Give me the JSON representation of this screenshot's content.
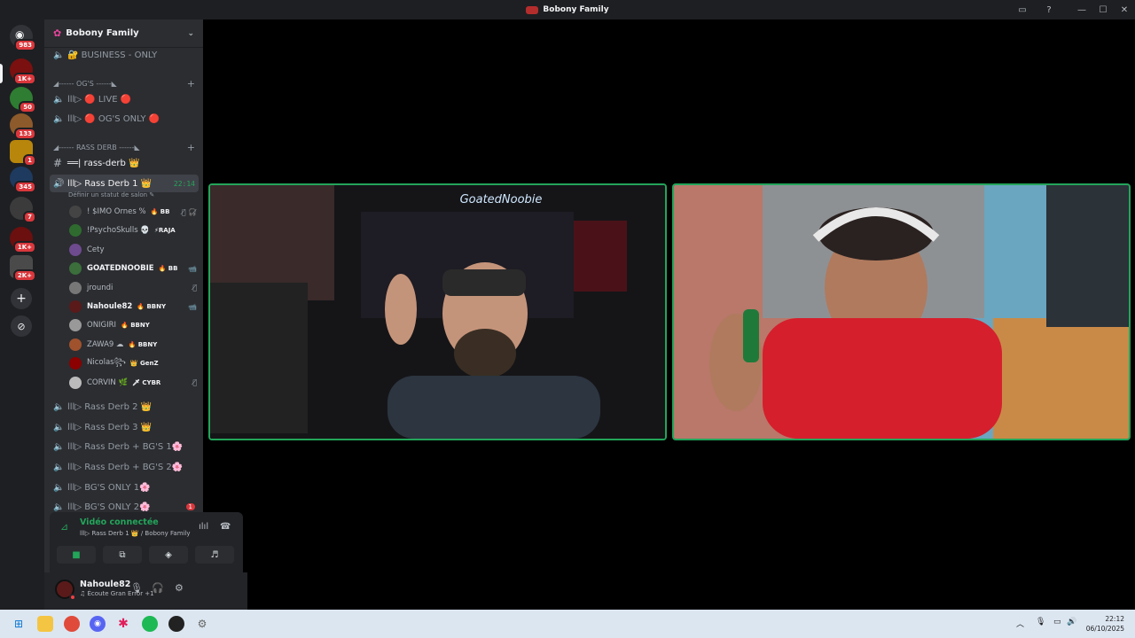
{
  "window": {
    "title": "Bobony Family",
    "controls": [
      "—",
      "☐",
      "✕"
    ]
  },
  "rail": {
    "servers": [
      {
        "name": "discord-home",
        "badge": "983",
        "color": "#313338"
      },
      {
        "name": "server-1",
        "badge": "1K+",
        "color": "#7a1010"
      },
      {
        "name": "server-2",
        "badge": "50",
        "color": "#2e7d32"
      },
      {
        "name": "server-3",
        "badge": "133",
        "color": "#8d5a2b"
      },
      {
        "name": "server-4",
        "badge": "1",
        "color": "#b8860b"
      },
      {
        "name": "server-5",
        "badge": "345",
        "color": "#1e3a5f"
      },
      {
        "name": "server-6",
        "badge": "7",
        "color": "#3b3b3b"
      },
      {
        "name": "server-7",
        "badge": "1K+",
        "color": "#6b0f0f"
      },
      {
        "name": "server-8",
        "badge": "2K+",
        "color": "#4a4a4a"
      }
    ]
  },
  "server": {
    "name": "Bobony Family"
  },
  "channels": {
    "business": "🔐 BUSINESS - ONLY",
    "cat_ogs": "◢------ OG'S ------◣",
    "live": "lll▷ 🔴 LIVE 🔴",
    "ogs_only": "lll▷ 🔴 OG'S ONLY 🔴",
    "cat_rass": "◢------ RASS DERB ------◣",
    "rass_text": "══| rass-derb 👑",
    "rass1": "lll▷ Rass Derb 1 👑",
    "rass1_time": "22:14",
    "rass1_status": "Définir un statut de salon ✎",
    "rass2": "lll▷ Rass Derb 2 👑",
    "rass3": "lll▷ Rass Derb 3 👑",
    "rass_bg1": "lll▷ Rass Derb + BG'S 1🌸",
    "rass_bg2": "lll▷ Rass Derb + BG'S 2🌸",
    "bg1": "lll▷ BG'S ONLY 1🌸",
    "bg2": "lll▷ BG'S ONLY 2🌸",
    "bg2_badge": "1"
  },
  "members": [
    {
      "name": "! $IMO Ornes %",
      "tag": "🔥 BB",
      "right": "🎙̸ 🎧̸",
      "color": "#444",
      "bold": false
    },
    {
      "name": "!PsychoSkulls 💀",
      "tag": "⚡RAJA",
      "right": "",
      "color": "#2f6b2f",
      "bold": false
    },
    {
      "name": "Cety",
      "tag": "",
      "right": "",
      "color": "#6e4a8e",
      "bold": false
    },
    {
      "name": "GOATEDNOOBIE",
      "tag": "🔥 BB",
      "right": "📹",
      "color": "#3b6e3b",
      "bold": true
    },
    {
      "name": "jroundi",
      "tag": "",
      "right": "🎙̸",
      "color": "#777",
      "bold": false
    },
    {
      "name": "Nahoule82",
      "tag": "🔥 BBNY",
      "right": "📹",
      "color": "#5a1a1a",
      "bold": true
    },
    {
      "name": "ONIGIRI",
      "tag": "🔥 BBNY",
      "right": "",
      "color": "#999",
      "bold": false
    },
    {
      "name": "ZAWA9 ☁",
      "tag": "🔥 BBNY",
      "right": "",
      "color": "#a0522d",
      "bold": false
    },
    {
      "name": "Nicolas꧂",
      "tag": "👑 GenZ",
      "right": "",
      "color": "#8b0000",
      "bold": false
    },
    {
      "name": "CORVIN 🌿",
      "tag": "🗡 CYBR",
      "right": "🎙̸",
      "color": "#bbb",
      "bold": false
    }
  ],
  "voice": {
    "connected": "Vidéo connectée",
    "location": "lll▷ Rass Derb 1 👑 / Bobony Family"
  },
  "user": {
    "name": "Nahoule82",
    "status": "♫ Écoute Gran Error +1"
  },
  "stream": {
    "overlay_text": "GoatedNoobie"
  },
  "taskbar": {
    "time": "22:12",
    "date": "06/10/2025"
  },
  "colors": {
    "accent_green": "#23a55a",
    "notification_red": "#da373c"
  }
}
